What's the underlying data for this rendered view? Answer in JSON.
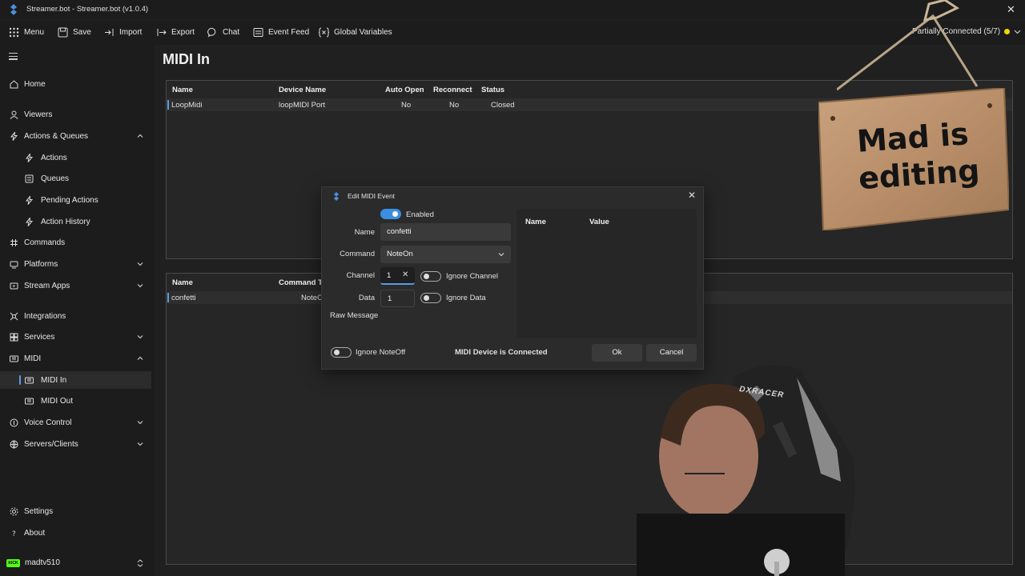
{
  "window": {
    "title": "Streamer.bot - Streamer.bot (v1.0.4)",
    "close": "✕"
  },
  "toolbar": {
    "menu": "Menu",
    "save": "Save",
    "import": "Import",
    "export": "Export",
    "chat": "Chat",
    "event_feed": "Event Feed",
    "global_variables": "Global Variables",
    "connection_status": "Partially Connected (5/7)",
    "connection_color": "#f2d600"
  },
  "sidebar": {
    "home": "Home",
    "viewers": "Viewers",
    "actions_queues": "Actions & Queues",
    "actions": "Actions",
    "queues": "Queues",
    "pending_actions": "Pending Actions",
    "action_history": "Action History",
    "commands": "Commands",
    "platforms": "Platforms",
    "stream_apps": "Stream Apps",
    "integrations": "Integrations",
    "services": "Services",
    "midi": "MIDI",
    "midi_in": "MIDI In",
    "midi_out": "MIDI Out",
    "voice_control": "Voice Control",
    "servers_clients": "Servers/Clients",
    "settings": "Settings",
    "about": "About",
    "user": "madtv510",
    "kick_badge": "KICK"
  },
  "page": {
    "title": "MIDI In"
  },
  "devices_table": {
    "headers": {
      "name": "Name",
      "device_name": "Device Name",
      "auto_open": "Auto Open",
      "reconnect": "Reconnect",
      "status": "Status"
    },
    "rows": [
      {
        "name": "LoopMidi",
        "device_name": "loopMIDI Port",
        "auto_open": "No",
        "reconnect": "No",
        "status": "Closed"
      }
    ]
  },
  "events_table": {
    "headers": {
      "name": "Name",
      "command": "Command T"
    },
    "rows": [
      {
        "name": "confetti",
        "command": "NoteO"
      }
    ]
  },
  "dialog": {
    "title": "Edit MIDI Event",
    "enabled_label": "Enabled",
    "name_label": "Name",
    "name_value": "confetti",
    "command_label": "Command",
    "command_value": "NoteOn",
    "channel_label": "Channel",
    "channel_value": "1",
    "ignore_channel_label": "Ignore Channel",
    "data_label": "Data",
    "data_value": "1",
    "ignore_data_label": "Ignore Data",
    "raw_message_label": "Raw Message",
    "ignore_noteoff_label": "Ignore NoteOff",
    "connected_status": "MIDI Device is Connected",
    "ok": "Ok",
    "cancel": "Cancel",
    "side_table": {
      "name_header": "Name",
      "value_header": "Value"
    },
    "enabled": true,
    "ignore_channel": false,
    "ignore_data": false,
    "ignore_noteoff": false
  },
  "overlay": {
    "sign_line1": "Mad is",
    "sign_line2": "editing",
    "chair_brand": "DXRACER"
  },
  "icons": [
    "app-logo-icon",
    "menu-grid-icon",
    "save-icon",
    "import-icon",
    "export-icon",
    "chat-icon",
    "event-feed-icon",
    "global-variables-icon",
    "chevron-down-icon",
    "home-icon",
    "viewers-icon",
    "bolt-icon",
    "queue-icon",
    "pending-icon",
    "history-icon",
    "commands-icon",
    "platforms-icon",
    "stream-apps-icon",
    "integrations-icon",
    "services-icon",
    "midi-icon",
    "voice-icon",
    "servers-icon",
    "settings-icon",
    "about-icon"
  ]
}
